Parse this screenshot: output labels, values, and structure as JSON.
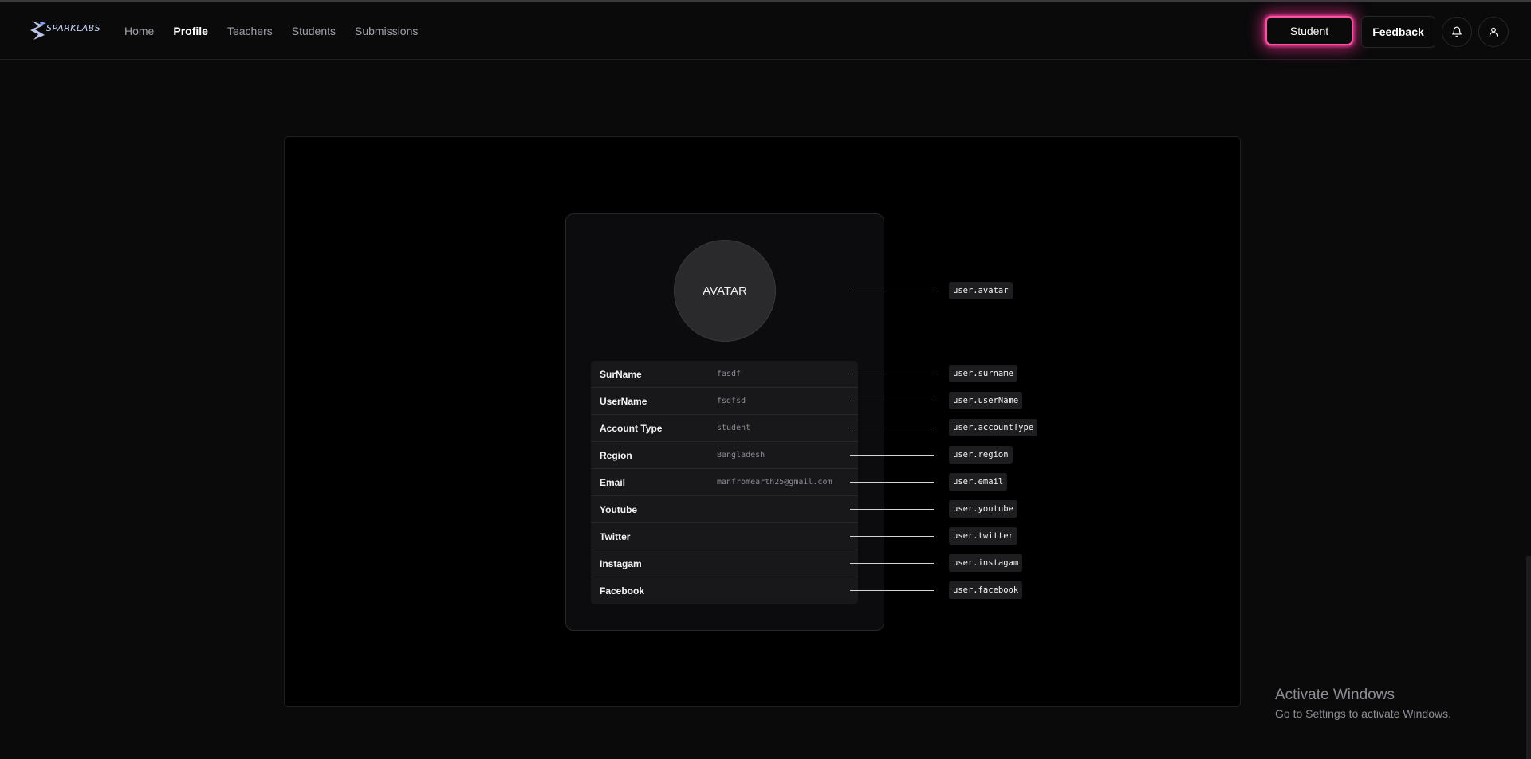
{
  "brand": {
    "logo_text": "SPARKLABS"
  },
  "nav": {
    "links": [
      {
        "label": "Home",
        "active": false
      },
      {
        "label": "Profile",
        "active": true
      },
      {
        "label": "Teachers",
        "active": false
      },
      {
        "label": "Students",
        "active": false
      },
      {
        "label": "Submissions",
        "active": false
      }
    ]
  },
  "header_actions": {
    "role_button": "Student",
    "feedback_button": "Feedback",
    "bell_icon": "bell-icon",
    "user_icon": "user-icon"
  },
  "profile": {
    "avatar_text": "AVATAR",
    "avatar_key": "user.avatar",
    "fields": [
      {
        "label": "SurName",
        "value": "fasdf",
        "key": "user.surname"
      },
      {
        "label": "UserName",
        "value": "fsdfsd",
        "key": "user.userName"
      },
      {
        "label": "Account Type",
        "value": "student",
        "key": "user.accountType"
      },
      {
        "label": "Region",
        "value": "Bangladesh",
        "key": "user.region"
      },
      {
        "label": "Email",
        "value": "manfromearth25@gmail.com",
        "key": "user.email"
      },
      {
        "label": "Youtube",
        "value": "",
        "key": "user.youtube"
      },
      {
        "label": "Twitter",
        "value": "",
        "key": "user.twitter"
      },
      {
        "label": "Instagam",
        "value": "",
        "key": "user.instagam"
      },
      {
        "label": "Facebook",
        "value": "",
        "key": "user.facebook"
      }
    ]
  },
  "watermark": {
    "title": "Activate Windows",
    "subtitle": "Go to Settings to activate Windows."
  },
  "colors": {
    "background": "#0a0a0b",
    "panel": "#000000",
    "accent_pink": "#ff4fa3"
  }
}
